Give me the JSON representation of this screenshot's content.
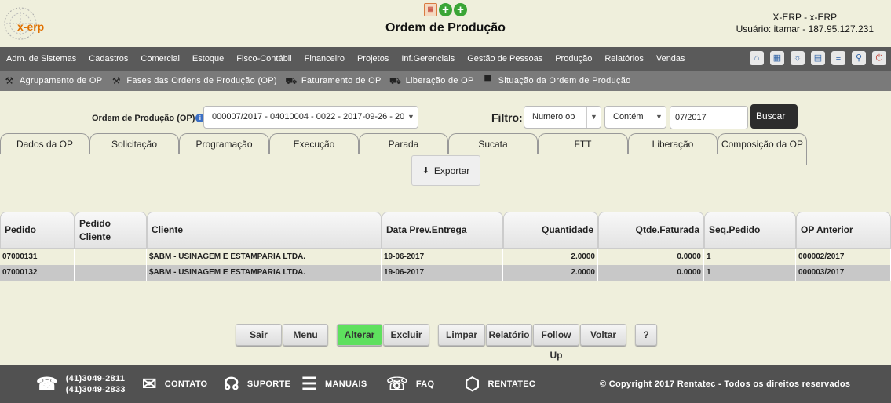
{
  "header": {
    "logo_text": "x-erp",
    "title": "Ordem de Produção",
    "user_line1": "X-ERP - x-ERP",
    "user_line2": "Usuário: itamar - 187.95.127.231"
  },
  "menu": {
    "items": [
      "Adm. de Sistemas",
      "Cadastros",
      "Comercial",
      "Estoque",
      "Fisco-Contábil",
      "Financeiro",
      "Projetos",
      "Inf.Gerenciais",
      "Gestão de Pessoas",
      "Produção",
      "Relatórios",
      "Vendas"
    ],
    "tools": [
      "home-icon",
      "save-icon",
      "bug-icon",
      "document-icon",
      "list-icon",
      "search-icon",
      "power-icon"
    ]
  },
  "subnav": {
    "items": [
      "Agrupamento de OP",
      "Fases das Ordens de Produção (OP)",
      "Faturamento de OP",
      "Liberação de OP",
      "Situação da Ordem de Produção"
    ]
  },
  "filter": {
    "op_label": "Ordem de Produção (OP)",
    "op_value": "000007/2017 - 04010004 - 0022 - 2017-09-26 - 20",
    "filtro_label": "Filtro:",
    "field_value": "Numero op",
    "operator_value": "Contém",
    "search_value": "07/2017",
    "search_button": "Buscar"
  },
  "tabs": [
    "Dados da OP",
    "Solicitação",
    "Programação",
    "Execução",
    "Parada",
    "Sucata",
    "FTT",
    "Liberação",
    "Composição da OP"
  ],
  "active_tab": "Composição da OP",
  "export_button": "Exportar",
  "table": {
    "headers": [
      "Pedido",
      "Pedido Cliente",
      "Cliente",
      "Data Prev.Entrega",
      "Quantidade",
      "Qtde.Faturada",
      "Seq.Pedido",
      "OP Anterior"
    ],
    "rows": [
      [
        "07000131",
        "",
        "$ABM - USINAGEM E ESTAMPARIA LTDA.",
        "19-06-2017",
        "2.0000",
        "0.0000",
        "1",
        "000002/2017"
      ],
      [
        "07000132",
        "",
        "$ABM - USINAGEM E ESTAMPARIA LTDA.",
        "19-06-2017",
        "2.0000",
        "0.0000",
        "1",
        "000003/2017"
      ]
    ]
  },
  "actions": {
    "sair": "Sair",
    "menu": "Menu",
    "alterar": "Alterar",
    "excluir": "Excluir",
    "limpar": "Limpar",
    "relatorio": "Relatório",
    "follow_up": "Follow Up",
    "voltar": "Voltar",
    "help": "?"
  },
  "footer": {
    "phone1": "(41)3049-2811",
    "phone2": "(41)3049-2833",
    "contato": "CONTATO",
    "suporte": "SUPORTE",
    "manuais": "MANUAIS",
    "faq": "FAQ",
    "rentatec": "RENTATEC",
    "copyright": "© Copyright 2017 Rentatec - Todos os direitos reservados"
  }
}
